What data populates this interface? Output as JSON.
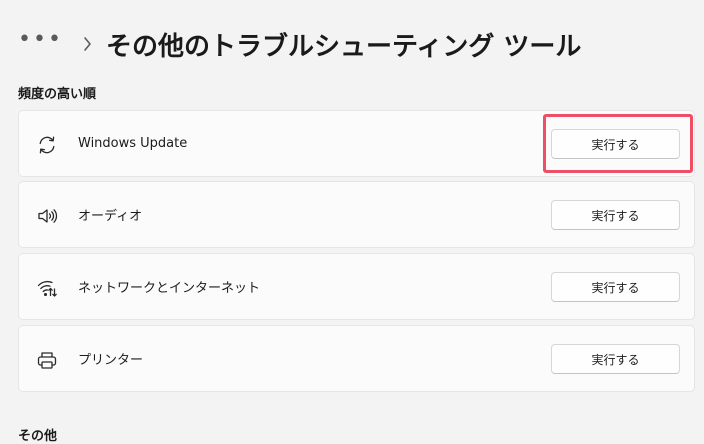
{
  "header": {
    "more_icon": "more-horizontal-icon",
    "separator_icon": "chevron-right-icon",
    "title": "その他のトラブルシューティング ツール"
  },
  "sections": [
    {
      "title": "頻度の高い順",
      "items": [
        {
          "label": "Windows Update",
          "icon": "sync-icon",
          "button": "実行する",
          "highlighted": true
        },
        {
          "label": "オーディオ",
          "icon": "speaker-icon",
          "button": "実行する"
        },
        {
          "label": "ネットワークとインターネット",
          "icon": "network-icon",
          "button": "実行する"
        },
        {
          "label": "プリンター",
          "icon": "printer-icon",
          "button": "実行する"
        }
      ]
    },
    {
      "title": "その他"
    }
  ],
  "colors": {
    "background": "#f3f3f3",
    "card": "#fbfbfb",
    "highlight": "#ef4f64"
  }
}
